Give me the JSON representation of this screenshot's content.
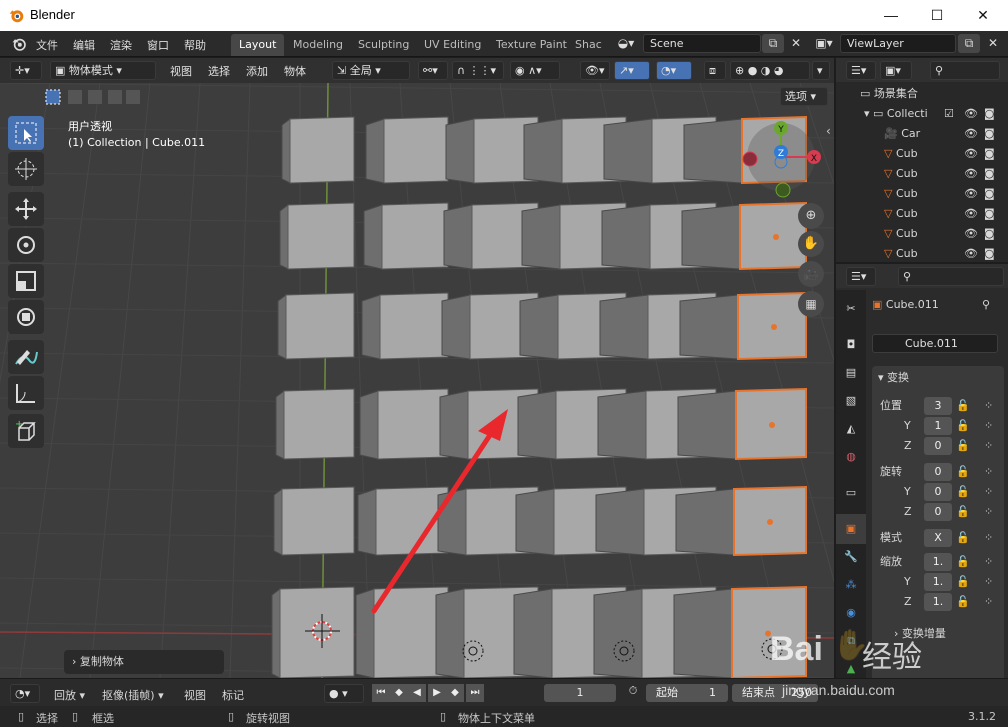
{
  "window": {
    "title": "Blender",
    "min_label": "—",
    "max_label": "☐",
    "close_label": "✕"
  },
  "menu": [
    "文件",
    "编辑",
    "渲染",
    "窗口",
    "帮助"
  ],
  "workspaces": [
    "Layout",
    "Modeling",
    "Sculpting",
    "UV Editing",
    "Texture Paint",
    "Shac"
  ],
  "scene": {
    "name": "Scene",
    "viewlayer": "ViewLayer"
  },
  "header": {
    "mode": "物体模式",
    "menus": [
      "视图",
      "选择",
      "添加",
      "物体"
    ],
    "orientation": "全局",
    "options": "选项"
  },
  "viewport": {
    "view_name": "用户透视",
    "context": "(1) Collection | Cube.011",
    "redo_panel": "复制物体"
  },
  "gizmo": {
    "y": "Y",
    "z": "Z",
    "x": "X"
  },
  "outliner": {
    "title": "场景集合",
    "collection": "Collecti",
    "items": [
      "Car",
      "Cub",
      "Cub",
      "Cub",
      "Cub",
      "Cub",
      "Cub"
    ]
  },
  "properties": {
    "object_name": "Cube.011",
    "data_name": "Cube.011",
    "section": "变换",
    "location_label": "位置",
    "rotation_label": "旋转",
    "mode_label": "模式",
    "scale_label": "缩放",
    "axis_y": "Y",
    "axis_z": "Z",
    "loc": [
      "3",
      "1",
      "0"
    ],
    "rot": [
      "0",
      "0",
      "0"
    ],
    "mode_value": "X",
    "scale": [
      "1.",
      "1.",
      "1."
    ],
    "delta": "变换增量"
  },
  "timeline": {
    "playback": "回放",
    "keying": "抠像(插帧)",
    "view": "视图",
    "marker": "标记",
    "frame": "1",
    "start_label": "起始",
    "start": "1",
    "end_label": "结束点",
    "end": "250"
  },
  "status": {
    "select": "选择",
    "box": "框选",
    "rotate": "旋转视图",
    "context_menu": "物体上下文菜单",
    "version": "3.1.2"
  },
  "colors": {
    "accent": "#4772b3",
    "selection": "#e8742c",
    "annotation_arrow": "#e8282c"
  },
  "watermark": {
    "brand": "Bai",
    "brand2": "经验",
    "url": "jingyan.baidu.com"
  }
}
